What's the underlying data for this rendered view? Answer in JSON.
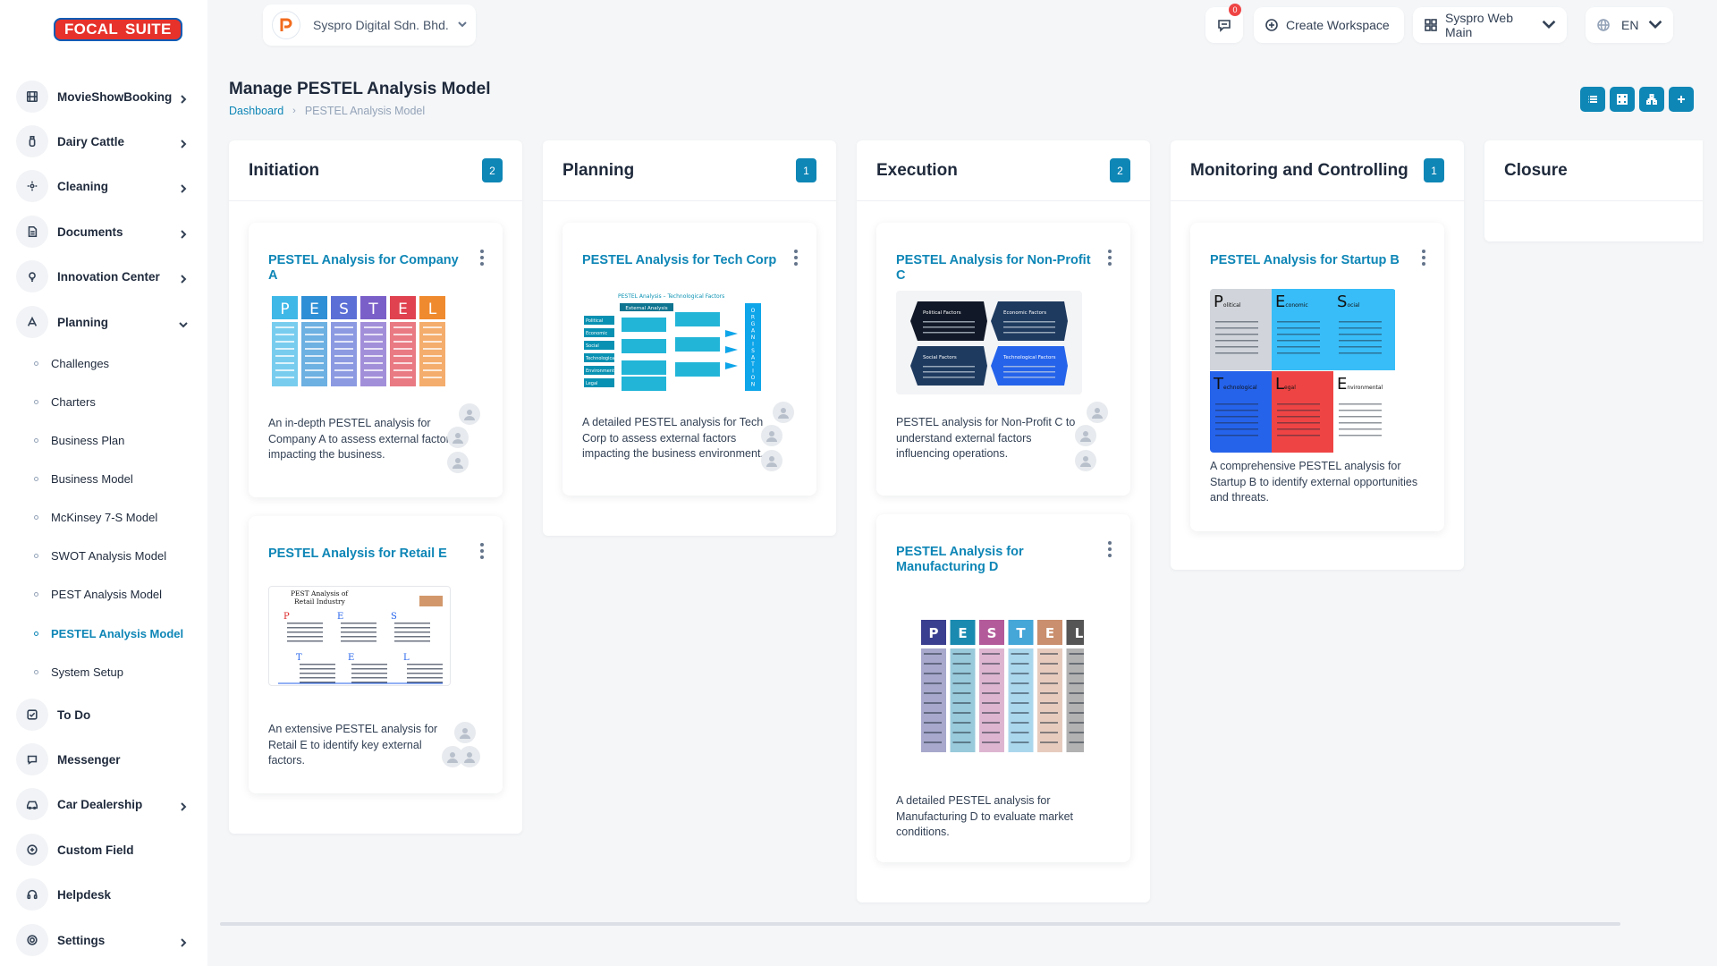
{
  "app": {
    "logo_part1": "FOCAL",
    "logo_part2": "SUITE"
  },
  "topbar": {
    "company": "Syspro Digital Sdn. Bhd.",
    "notif_count": "0",
    "create_workspace": "Create Workspace",
    "workspace": "Syspro Web Main",
    "language": "EN"
  },
  "sidebar": {
    "items": [
      {
        "label": "MovieShowBooking",
        "icon": "film-icon"
      },
      {
        "label": "Dairy Cattle",
        "icon": "bottle-icon"
      },
      {
        "label": "Cleaning",
        "icon": "sparkle-icon"
      },
      {
        "label": "Documents",
        "icon": "file-icon"
      },
      {
        "label": "Innovation Center",
        "icon": "bulb-icon"
      },
      {
        "label": "Planning",
        "icon": "planning-icon"
      },
      {
        "label": "To Do",
        "icon": "check-icon"
      },
      {
        "label": "Messenger",
        "icon": "chat-icon"
      },
      {
        "label": "Car Dealership",
        "icon": "car-icon"
      },
      {
        "label": "Custom Field",
        "icon": "plus-circle-icon"
      },
      {
        "label": "Helpdesk",
        "icon": "headset-icon"
      },
      {
        "label": "Settings",
        "icon": "gear-icon"
      }
    ],
    "planning_sub": [
      "Challenges",
      "Charters",
      "Business Plan",
      "Business Model",
      "McKinsey 7-S Model",
      "SWOT Analysis Model",
      "PEST Analysis Model",
      "PESTEL Analysis Model",
      "System Setup"
    ]
  },
  "header": {
    "title": "Manage PESTEL Analysis Model",
    "crumb_home": "Dashboard",
    "crumb_current": "PESTEL Analysis Model"
  },
  "columns": [
    {
      "title": "Initiation",
      "count": "2"
    },
    {
      "title": "Planning",
      "count": "1"
    },
    {
      "title": "Execution",
      "count": "2"
    },
    {
      "title": "Monitoring and Controlling",
      "count": "1"
    },
    {
      "title": "Closure",
      "count": ""
    }
  ],
  "cards": {
    "company_a": {
      "title": "PESTEL Analysis for Company A",
      "desc": "An in-depth PESTEL analysis for Company A to assess external factors impacting the business."
    },
    "retail_e": {
      "title": "PESTEL Analysis for Retail E",
      "desc": "An extensive PESTEL analysis for Retail E to identify key external factors."
    },
    "tech_corp": {
      "title": "PESTEL Analysis for Tech Corp",
      "desc": "A detailed PESTEL analysis for Tech Corp to assess external factors impacting the business environment."
    },
    "non_profit_c": {
      "title": "PESTEL Analysis for Non-Profit C",
      "desc": "PESTEL analysis for Non-Profit C to understand external factors influencing operations."
    },
    "manufacturing_d": {
      "title": "PESTEL Analysis for Manufacturing D",
      "desc": "A detailed PESTEL analysis for Manufacturing D to evaluate market conditions."
    },
    "startup_b": {
      "title": "PESTEL Analysis for Startup B",
      "desc": "A comprehensive PESTEL analysis for Startup B to identify external opportunities and threats."
    }
  },
  "images": {
    "pestel_letters": [
      "P",
      "E",
      "S",
      "T",
      "E",
      "L"
    ],
    "company_a_colors": [
      "#3fb8e8",
      "#2f8fd6",
      "#5b6fd6",
      "#7b5fc9",
      "#e0424f",
      "#f08a2e"
    ],
    "manufacturing_colors": [
      "#3b3f8f",
      "#1a8ab0",
      "#b35a9a",
      "#45a6d8",
      "#c98f6e",
      "#555555"
    ],
    "retail_title": "PEST Analysis of Retail Industry",
    "tech_title": "PESTEL Analysis – Technological Factors",
    "tech_header": "External Analysis",
    "tech_rows": [
      "Political",
      "Economic",
      "Social",
      "Technological",
      "Environmental",
      "Legal"
    ],
    "tech_side": "ORGANISATION",
    "nonprofit_quads": [
      "Political Factors",
      "Economic Factors",
      "Social Factors",
      "Technological Factors"
    ],
    "startup_quads": [
      {
        "big": "P",
        "rest": "olitical"
      },
      {
        "big": "E",
        "rest": "conomic"
      },
      {
        "big": "S",
        "rest": "ocial"
      },
      {
        "big": "T",
        "rest": "echnological"
      },
      {
        "big": "L",
        "rest": "egal"
      },
      {
        "big": "E",
        "rest": "nvironmental"
      }
    ]
  }
}
